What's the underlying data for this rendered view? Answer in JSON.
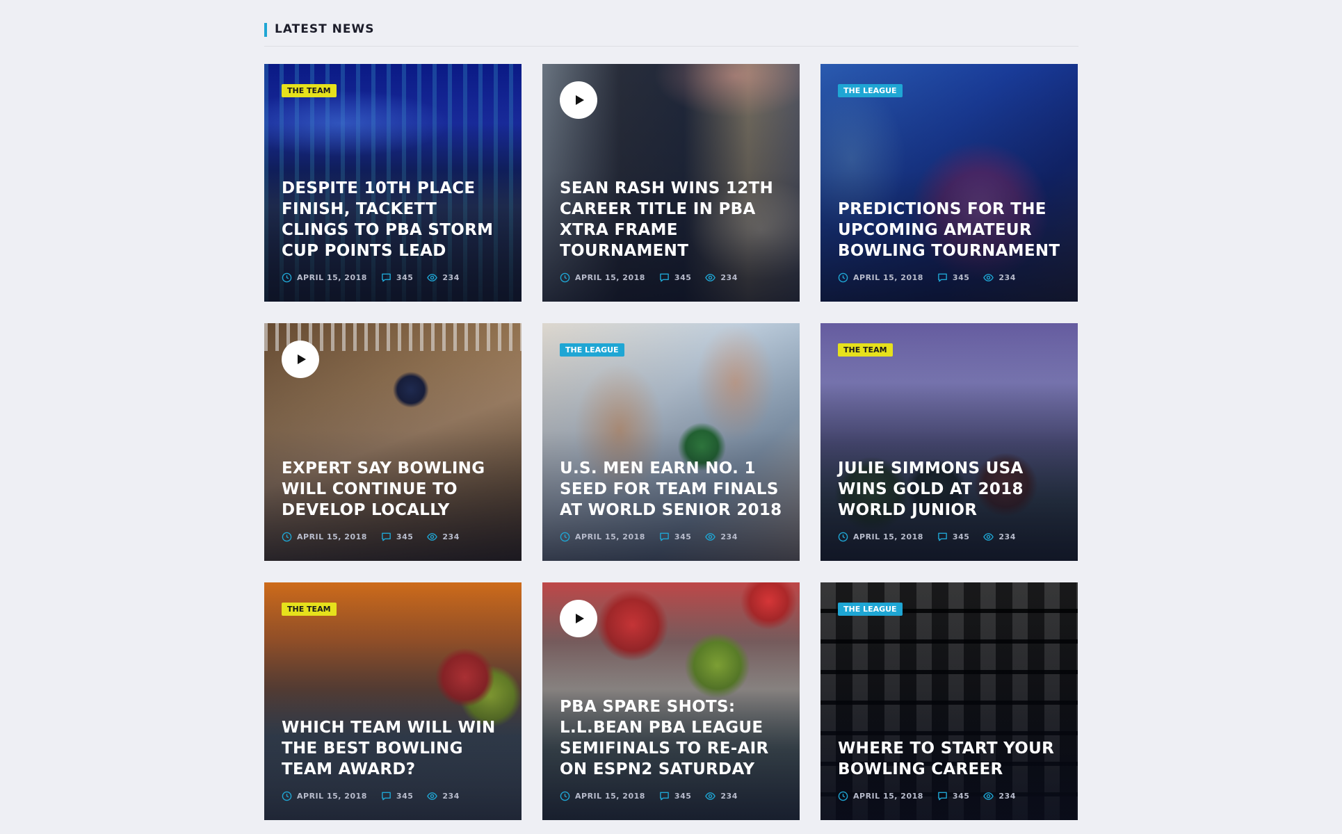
{
  "section": {
    "title": "LATEST NEWS"
  },
  "icons": {
    "date": "clock-icon",
    "comments": "comment-bubble-icon",
    "views": "eye-icon",
    "play": "play-icon"
  },
  "colors": {
    "accent": "#1fa6d4",
    "tag_team": "#e6e11c",
    "tag_league": "#1fa6d4",
    "background": "#eeeff4"
  },
  "cards": [
    {
      "tag": "THE TEAM",
      "tag_type": "team",
      "video": false,
      "title": "DESPITE 10TH PLACE FINISH, TACKETT CLINGS TO PBA STORM CUP POINTS LEAD",
      "date": "APRIL 15, 2018",
      "comments": "345",
      "views": "234"
    },
    {
      "tag": "",
      "tag_type": "",
      "video": true,
      "title": "SEAN RASH WINS 12TH CAREER TITLE IN PBA XTRA FRAME TOURNAMENT",
      "date": "APRIL 15, 2018",
      "comments": "345",
      "views": "234"
    },
    {
      "tag": "THE LEAGUE",
      "tag_type": "league",
      "video": false,
      "title": "PREDICTIONS FOR THE UPCOMING AMATEUR BOWLING TOURNAMENT",
      "date": "APRIL 15, 2018",
      "comments": "345",
      "views": "234"
    },
    {
      "tag": "",
      "tag_type": "",
      "video": true,
      "title": "EXPERT SAY BOWLING WILL CONTINUE TO DEVELOP LOCALLY",
      "date": "APRIL 15, 2018",
      "comments": "345",
      "views": "234"
    },
    {
      "tag": "THE LEAGUE",
      "tag_type": "league",
      "video": false,
      "title": "U.S. MEN EARN NO. 1 SEED FOR TEAM FINALS AT WORLD SENIOR 2018",
      "date": "APRIL 15, 2018",
      "comments": "345",
      "views": "234"
    },
    {
      "tag": "THE TEAM",
      "tag_type": "team",
      "video": false,
      "title": "JULIE SIMMONS USA WINS GOLD AT 2018 WORLD JUNIOR",
      "date": "APRIL 15, 2018",
      "comments": "345",
      "views": "234"
    },
    {
      "tag": "THE TEAM",
      "tag_type": "team",
      "video": false,
      "title": "WHICH TEAM WILL WIN THE BEST BOWLING TEAM AWARD?",
      "date": "APRIL 15, 2018",
      "comments": "345",
      "views": "234"
    },
    {
      "tag": "",
      "tag_type": "",
      "video": true,
      "title": "PBA SPARE SHOTS: L.L.BEAN PBA LEAGUE SEMIFINALS TO RE-AIR ON ESPN2 SATURDAY",
      "date": "APRIL 15, 2018",
      "comments": "345",
      "views": "234"
    },
    {
      "tag": "THE LEAGUE",
      "tag_type": "league",
      "video": false,
      "title": "WHERE TO START YOUR BOWLING CAREER",
      "date": "APRIL 15, 2018",
      "comments": "345",
      "views": "234"
    }
  ]
}
